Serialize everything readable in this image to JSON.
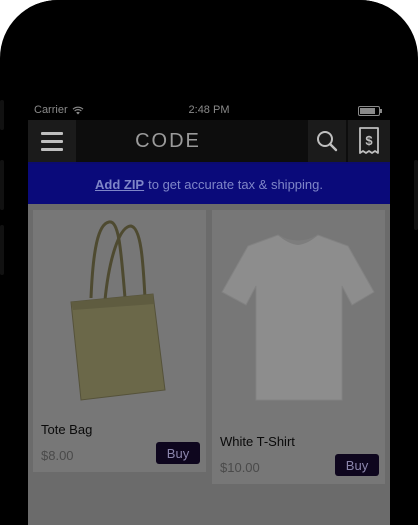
{
  "status_bar": {
    "carrier": "Carrier",
    "time": "2:48 PM",
    "battery_level": 0.85
  },
  "nav": {
    "brand": "CODE"
  },
  "banner": {
    "link_text": "Add ZIP",
    "text": "to get accurate tax & shipping."
  },
  "products": [
    {
      "name": "Tote Bag",
      "price": "$8.00",
      "buy_label": "Buy",
      "image_icon": "tote-bag-image"
    },
    {
      "name": "White T-Shirt",
      "price": "$10.00",
      "buy_label": "Buy",
      "image_icon": "tshirt-image"
    }
  ],
  "colors": {
    "banner_bg": "#0a0a7a",
    "buy_bg": "#0e061e",
    "navbar_bg": "#0d0d0d"
  }
}
